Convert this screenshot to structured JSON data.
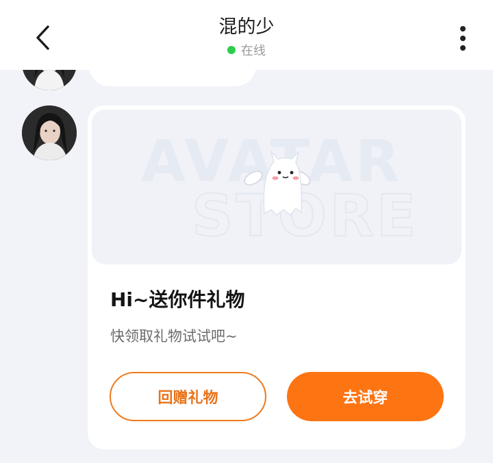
{
  "header": {
    "contact_name": "混的少",
    "status": "在线",
    "status_color": "#2fcc4d"
  },
  "icons": {
    "back": "chevron-left-icon",
    "more": "more-vertical-icon"
  },
  "gift_card": {
    "banner_watermark_line1": "AVATAR",
    "banner_watermark_line2": "STORE",
    "title": "Hi~送你件礼物",
    "subtitle": "快领取礼物试试吧~",
    "secondary_button": "回赠礼物",
    "primary_button": "去试穿",
    "accent_color": "#fd7412"
  }
}
